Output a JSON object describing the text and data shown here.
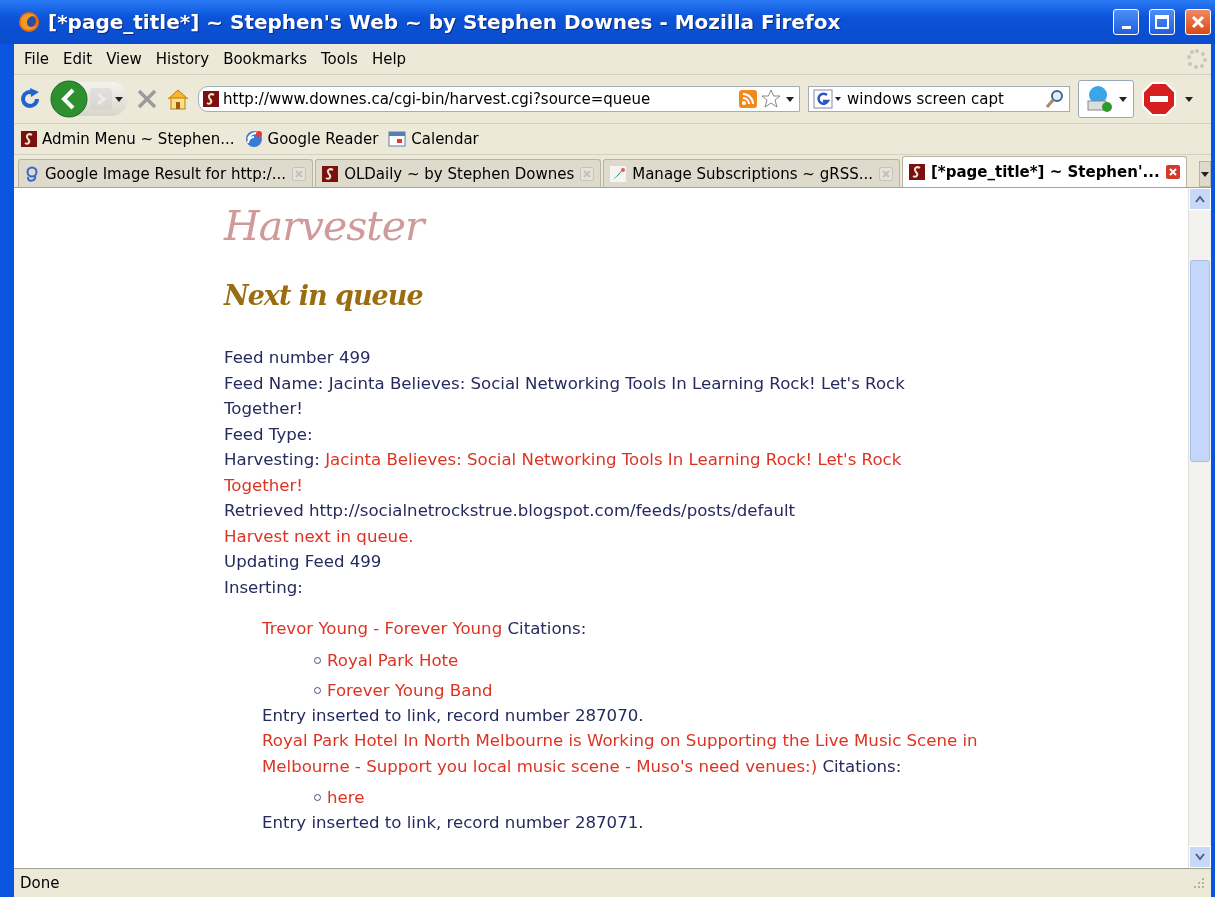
{
  "window": {
    "title": "[*page_title*] ~ Stephen's Web ~ by Stephen Downes - Mozilla Firefox"
  },
  "menu": [
    "File",
    "Edit",
    "View",
    "History",
    "Bookmarks",
    "Tools",
    "Help"
  ],
  "address_bar": {
    "value": "http://www.downes.ca/cgi-bin/harvest.cgi?source=queue"
  },
  "search": {
    "value": "windows screen capt"
  },
  "bookmarks": [
    {
      "label": "Admin Menu ~ Stephen...",
      "kind": "site"
    },
    {
      "label": "Google Reader",
      "kind": "reader"
    },
    {
      "label": "Calendar",
      "kind": "calendar"
    }
  ],
  "tabs": [
    {
      "label": "Google Image Result for http:/...",
      "kind": "google",
      "selected": false
    },
    {
      "label": "OLDaily ~ by Stephen Downes",
      "kind": "site",
      "selected": false
    },
    {
      "label": "Manage Subscriptions ~ gRSS...",
      "kind": "feather",
      "selected": false
    },
    {
      "label": "[*page_title*] ~ Stephen'...",
      "kind": "site",
      "selected": true
    }
  ],
  "page": {
    "heading": "Harvester",
    "subheading": "Next in queue",
    "lines": [
      {
        "kind": "text",
        "text": "Feed number 499"
      },
      {
        "kind": "text",
        "text": "Feed Name: Jacinta Believes: Social Networking Tools In Learning Rock! Let's Rock Together!"
      },
      {
        "kind": "text",
        "text": "Feed Type:"
      },
      {
        "kind": "labeled_link",
        "label": "Harvesting:",
        "link": "Jacinta Believes: Social Networking Tools In Learning Rock! Let's Rock Together!"
      },
      {
        "kind": "text",
        "text": "Retrieved http://socialnetrockstrue.blogspot.com/feeds/posts/default"
      },
      {
        "kind": "link",
        "text": "Harvest next in queue."
      },
      {
        "kind": "text",
        "text": "Updating Feed 499"
      },
      {
        "kind": "text",
        "text": "Inserting:"
      }
    ],
    "entries": [
      {
        "title": "Trevor Young - Forever Young",
        "label": "Citations:",
        "citations": [
          "Royal Park Hote",
          "Forever Young Band"
        ],
        "result": "Entry inserted to link, record number 287070."
      },
      {
        "title": "Royal Park Hotel In North Melbourne is Working on Supporting the Live Music Scene in Melbourne - Support you local music scene - Muso's need venues:)",
        "label": "Citations:",
        "citations": [
          "here"
        ],
        "result": "Entry inserted to link, record number 287071."
      }
    ]
  },
  "status_bar": {
    "text": "Done"
  }
}
